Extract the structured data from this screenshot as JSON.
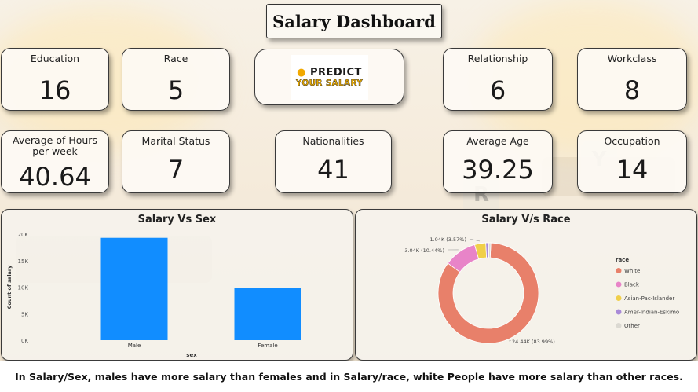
{
  "title": "Salary Dashboard",
  "cards": {
    "education": {
      "label": "Education",
      "value": "16"
    },
    "race": {
      "label": "Race",
      "value": "5"
    },
    "relationship": {
      "label": "Relationship",
      "value": "6"
    },
    "workclass": {
      "label": "Workclass",
      "value": "8"
    },
    "hours": {
      "label": "Average of Hours per week",
      "value": "40.64"
    },
    "marital": {
      "label": "Marital Status",
      "value": "7"
    },
    "nationalities": {
      "label": "Nationalities",
      "value": "41"
    },
    "age": {
      "label": "Average Age",
      "value": "39.25"
    },
    "occupation": {
      "label": "Occupation",
      "value": "14"
    }
  },
  "logo": {
    "line1": "PREDICT",
    "line2": "YOUR SALARY",
    "icon": "coin-icon"
  },
  "footer": "In Salary/Sex, males have more salary than females and in Salary/race, white People have more salary than other races.",
  "chart_data": [
    {
      "type": "bar",
      "title": "Salary Vs Sex",
      "xlabel": "sex",
      "ylabel": "Count of salary",
      "categories": [
        "Male",
        "Female"
      ],
      "values": [
        19300,
        9800
      ],
      "ylim": [
        0,
        20000
      ],
      "yticks": [
        "0K",
        "5K",
        "10K",
        "15K",
        "20K"
      ],
      "color": "#118dff",
      "grid": false
    },
    {
      "type": "pie",
      "title": "Salary V/s Race",
      "legend_title": "race",
      "legend_position": "right",
      "slices": [
        {
          "name": "White",
          "value": 24440,
          "label": "24.44K (83.99%)",
          "color": "#e8806a"
        },
        {
          "name": "Black",
          "value": 3040,
          "label": "3.04K (10.44%)",
          "color": "#e884c8"
        },
        {
          "name": "Asian-Pac-Islander",
          "value": 1040,
          "label": "1.04K (3.57%)",
          "color": "#f0cf4a"
        },
        {
          "name": "Amer-Indian-Eskimo",
          "value": 290,
          "label": "",
          "color": "#a98bd8"
        },
        {
          "name": "Other",
          "value": 180,
          "label": "",
          "color": "#dbd9d2"
        }
      ]
    }
  ]
}
